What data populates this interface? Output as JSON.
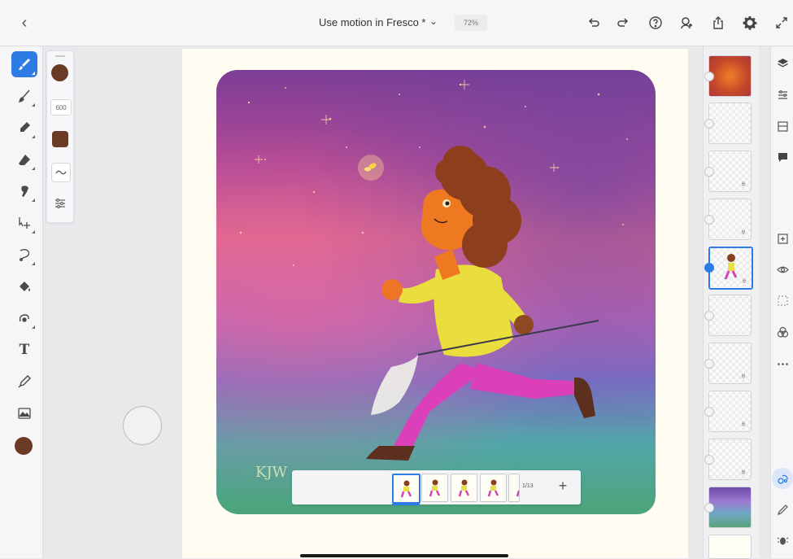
{
  "topbar": {
    "document_title": "Use motion in Fresco *",
    "zoom_level": "72%",
    "icons": [
      "back-icon",
      "title-dropdown-icon",
      "undo-icon",
      "redo-icon",
      "help-icon",
      "invite-icon",
      "share-icon",
      "settings-icon",
      "fullscreen-icon"
    ]
  },
  "tools": {
    "items": [
      "pixel-brush",
      "live-brush",
      "vector-brush",
      "eraser",
      "smudge",
      "move-transform",
      "selection",
      "fill",
      "liquify",
      "text",
      "eyedropper",
      "place-image",
      "color"
    ],
    "text_tool_label": "T",
    "current_color": "#6b3a25",
    "accent": "#2d7be5"
  },
  "brush_palette": {
    "size_value": "600",
    "brush_color": "#6b3a25"
  },
  "frames": {
    "counter": "1/13",
    "add_label": "+",
    "visible_count": 5
  },
  "layers": {
    "count": 11,
    "selected_index": 4
  },
  "right_rail": {
    "icons": [
      "layers-icon",
      "layer-properties-icon",
      "layer-actions-icon",
      "comments-icon",
      "add-layer-icon",
      "visibility-icon",
      "mask-icon",
      "blend-icon",
      "more-icon",
      "motion-icon",
      "pen-icon",
      "bug-icon"
    ]
  }
}
